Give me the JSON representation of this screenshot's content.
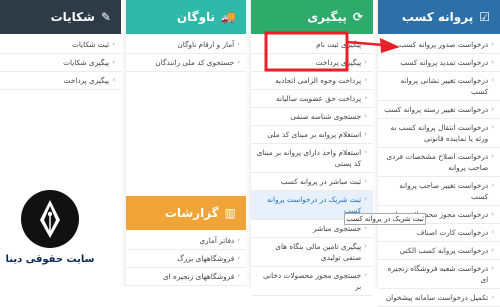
{
  "license": {
    "title": "پروانه کسب",
    "items": [
      {
        "label": "درخواست صدور پروانه کسب"
      },
      {
        "label": "درخواست تمدید پروانه کسب"
      },
      {
        "label": "درخواست تغییر نشانی پروانه کسب"
      },
      {
        "label": "درخواست تغییر رسته پروانه کسب"
      },
      {
        "label": "درخواست انتقال پروانه کسب به ورثه یا نماینده قانونی"
      },
      {
        "label": "درخواست اصلاح مشخصات فردی صاحب پروانه"
      },
      {
        "label": "درخواست تغییر صاحب پروانه کسب"
      },
      {
        "label": "درخواست مجوز محصولات دخانی"
      },
      {
        "label": "درخواست کارت اصناف"
      },
      {
        "label": "درخواست پروانه کسب الکتی"
      },
      {
        "label": "درخواست شعبه فروشگاه زنجیره ای"
      },
      {
        "label": "تکمیل درخواست سامانه پیشخوان"
      }
    ]
  },
  "tracking": {
    "title": "پیگیری",
    "items": [
      {
        "label": "پیگیری ثبت نام"
      },
      {
        "label": "پیگیری پرداخت"
      },
      {
        "label": "پرداخت وجوه الزامی اتحادیه"
      },
      {
        "label": "پرداخت حق عضویت سالیانه"
      },
      {
        "label": "جستجوی شناسه صنفی"
      },
      {
        "label": "استعلام پروانه بر مبنای کد ملی"
      },
      {
        "label": "استعلام واحد دارای پروانه بر مبنای کد پستی"
      },
      {
        "label": "ثبت مباشر در پروانه کسب"
      },
      {
        "label": "ثبت شریک در درخواست پروانه کسب"
      },
      {
        "label": "جستجوی مباشر"
      },
      {
        "label": "پیگیری تامین مالی بنگاه های صنفی تولیدی"
      },
      {
        "label": "جستجوی مجوز محصولات دخانی بر"
      }
    ]
  },
  "fleet": {
    "title": "ناوگان",
    "items": [
      {
        "label": "آمار و ارقام ناوگان"
      },
      {
        "label": "جستجوی کد ملی رانندگان"
      }
    ]
  },
  "reports": {
    "title": "گزارشات",
    "items": [
      {
        "label": "دفاتر آماری"
      },
      {
        "label": "فروشگاههای بزرگ"
      },
      {
        "label": "فروشگاههای زنجیره ای"
      }
    ]
  },
  "complaints": {
    "title": "شکایات",
    "items": [
      {
        "label": "ثبت شکایات"
      },
      {
        "label": "پیگیری شکایات"
      },
      {
        "label": "پیگیری پرداخت"
      }
    ]
  },
  "tooltip": "ثبت شریک در پروانه کسب",
  "logo": {
    "site_name": "سایت حقوقی دینا"
  },
  "colors": {
    "license": "#2d6fa7",
    "tracking": "#2eaa6b",
    "fleet": "#2fb9a8",
    "reports": "#f0a437",
    "complaints": "#2e3b46",
    "arrow": "#e8202a"
  }
}
